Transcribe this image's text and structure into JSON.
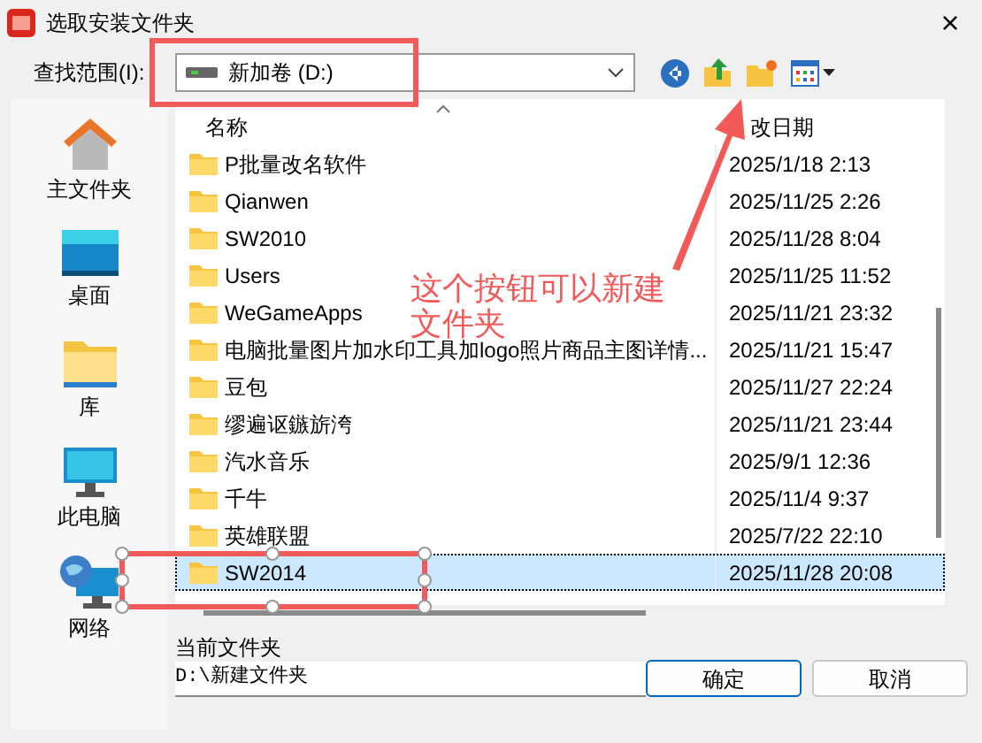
{
  "window": {
    "title": "选取安装文件夹",
    "close": "×"
  },
  "look_in": {
    "label": "查找范围(I):",
    "value": "新加卷 (D:)"
  },
  "sidebar": {
    "items": [
      {
        "label": "主文件夹",
        "kind": "home"
      },
      {
        "label": "桌面",
        "kind": "desktop"
      },
      {
        "label": "库",
        "kind": "library"
      },
      {
        "label": "此电脑",
        "kind": "computer"
      },
      {
        "label": "网络",
        "kind": "network"
      }
    ]
  },
  "table": {
    "columns": [
      "名称",
      "改日期"
    ],
    "rows": [
      {
        "name": "P批量改名软件",
        "date": "2025/1/18 2:13",
        "selected": false
      },
      {
        "name": "Qianwen",
        "date": "2025/11/25 2:26",
        "selected": false
      },
      {
        "name": "SW2010",
        "date": "2025/11/28 8:04",
        "selected": false
      },
      {
        "name": "Users",
        "date": "2025/11/25 11:52",
        "selected": false
      },
      {
        "name": "WeGameApps",
        "date": "2025/11/21 23:32",
        "selected": false
      },
      {
        "name": "电脑批量图片加水印工具加logo照片商品主图详情...",
        "date": "2025/11/21 15:47",
        "selected": false
      },
      {
        "name": "豆包",
        "date": "2025/11/27 22:24",
        "selected": false
      },
      {
        "name": "缪遍讴鏃旂洿",
        "date": "2025/11/21 23:44",
        "selected": false
      },
      {
        "name": "汽水音乐",
        "date": "2025/9/1 12:36",
        "selected": false
      },
      {
        "name": "千牛",
        "date": "2025/11/4 9:37",
        "selected": false
      },
      {
        "name": "英雄联盟",
        "date": "2025/7/22 22:10",
        "selected": false
      },
      {
        "name": "SW2014",
        "date": "2025/11/28 20:08",
        "selected": true
      }
    ]
  },
  "current_folder": {
    "label": "当前文件夹",
    "value": "D:\\新建文件夹"
  },
  "buttons": [
    "确定",
    "取消"
  ],
  "annotation": {
    "note": "这个按钮可以新建文件夹"
  }
}
